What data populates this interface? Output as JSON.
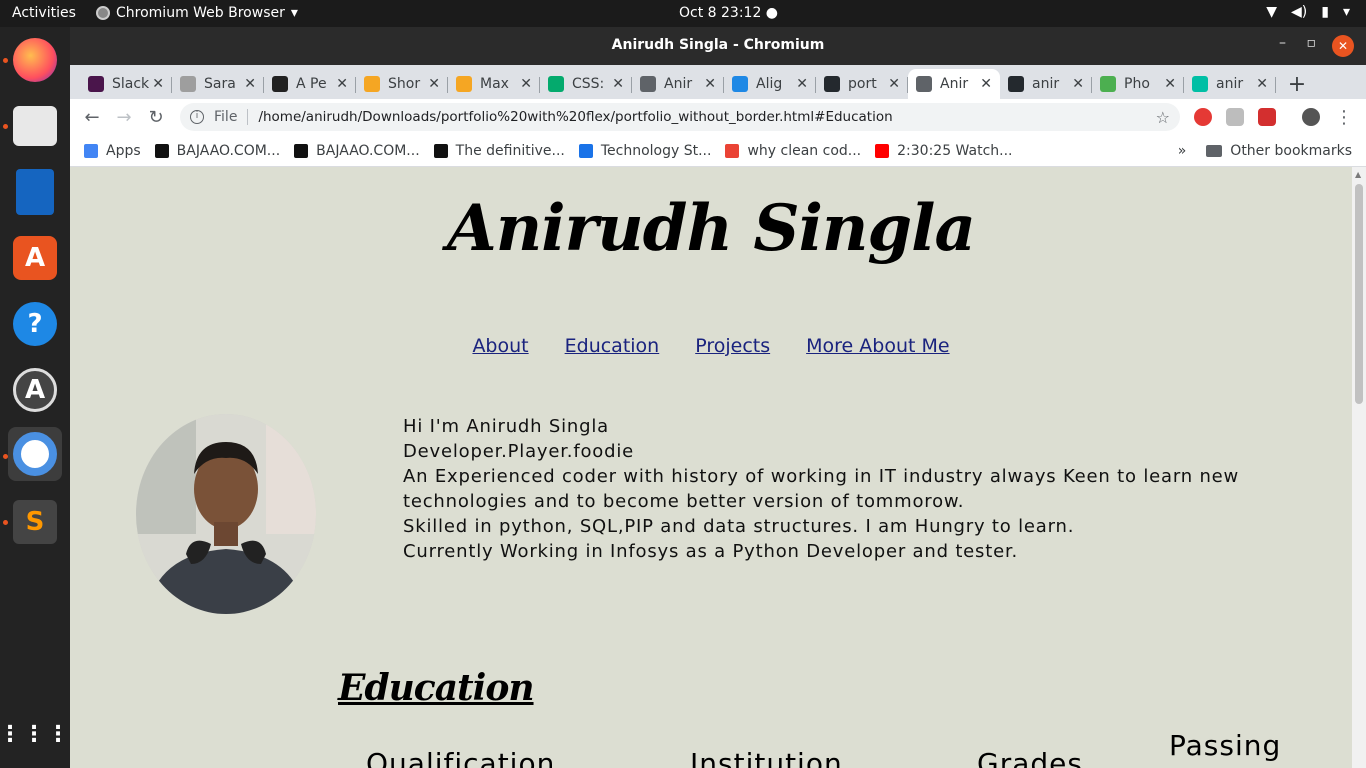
{
  "system": {
    "activities": "Activities",
    "app_name": "Chromium Web Browser",
    "clock": "Oct 8  23:12"
  },
  "window": {
    "title": "Anirudh Singla - Chromium"
  },
  "tabs": [
    {
      "label": "Slack",
      "color": "#4a154b"
    },
    {
      "label": "Sara",
      "color": "#9e9e9e"
    },
    {
      "label": "A Pe",
      "color": "#222222"
    },
    {
      "label": "Shor",
      "color": "#f5a623"
    },
    {
      "label": "Max",
      "color": "#f5a623"
    },
    {
      "label": "CSS:",
      "color": "#04aa6d"
    },
    {
      "label": "Anir",
      "color": "#5f6368"
    },
    {
      "label": "Alig",
      "color": "#1e88e5"
    },
    {
      "label": "port",
      "color": "#24292e"
    },
    {
      "label": "Anir",
      "color": "#5f6368",
      "active": true
    },
    {
      "label": "anir",
      "color": "#24292e"
    },
    {
      "label": "Pho",
      "color": "#4caf50"
    },
    {
      "label": "anir",
      "color": "#00bfa5"
    }
  ],
  "toolbar": {
    "scheme": "File",
    "url": "/home/anirudh/Downloads/portfolio%20with%20flex/portfolio_without_border.html#Education"
  },
  "bookmarks": [
    {
      "label": "Apps",
      "color": "#4285f4"
    },
    {
      "label": "BAJAAO.COM...",
      "color": "#111111"
    },
    {
      "label": "BAJAAO.COM...",
      "color": "#111111"
    },
    {
      "label": "The definitive...",
      "color": "#111111"
    },
    {
      "label": "Technology St...",
      "color": "#1a73e8"
    },
    {
      "label": "why clean cod...",
      "color": "#ea4335"
    },
    {
      "label": "2:30:25 Watch...",
      "color": "#ff0000"
    }
  ],
  "bookmarks_more": "»",
  "other_bookmarks": "Other bookmarks",
  "page": {
    "name": "Anirudh Singla",
    "nav": [
      "About",
      "Education",
      "Projects",
      "More About Me"
    ],
    "intro": [
      "Hi I'm Anirudh Singla",
      "Developer.Player.foodie",
      "An Experienced coder with history of working in IT industry always Keen to learn new technologies and to become better version of tommorow.",
      "Skilled in python, SQL,PIP and data structures. I am Hungry to learn.",
      "Currently Working in Infosys as a Python Developer and tester."
    ],
    "education_title": "Education",
    "table_headers": [
      "Qualification",
      "Institution",
      "Grades",
      "Passing"
    ]
  }
}
